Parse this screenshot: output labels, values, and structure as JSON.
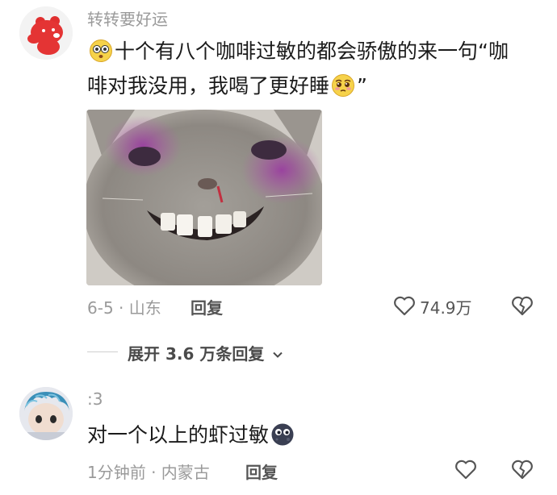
{
  "comments": [
    {
      "username": "转转要好运",
      "text_line1": "十个有八个咖啡过敏的都会骄傲的来一句“咖",
      "text_line2": "啡对我没用，我喝了更好睡",
      "text_line2_end": "”",
      "date_location": "6-5 · 山东",
      "reply_label": "回复",
      "like_count": "74.9万"
    },
    {
      "username": ":3",
      "text": "对一个以上的虾过敏",
      "date_location": "1分钟前 · 内蒙古",
      "reply_label": "回复"
    }
  ],
  "expand_replies": {
    "label": "展开 3.6 万条回复"
  },
  "icons": {
    "like": "heart-outline-icon",
    "dislike": "broken-heart-icon",
    "expand": "chevron-down-icon"
  },
  "colors": {
    "username": "#9a9a9a",
    "text": "#1b1b1b",
    "meta": "#9a9a9a"
  }
}
